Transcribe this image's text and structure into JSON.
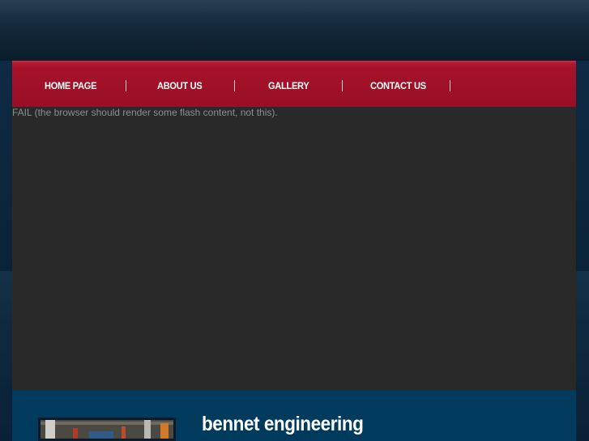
{
  "nav": {
    "items": [
      {
        "label": "HOME PAGE"
      },
      {
        "label": "ABOUT US"
      },
      {
        "label": "GALLERY"
      },
      {
        "label": "CONTACT US"
      }
    ]
  },
  "flash": {
    "fallback_text": "FAIL (the browser should render some flash content, not this)."
  },
  "content": {
    "site_title": "bennet engineering"
  },
  "colors": {
    "nav_red": "#a5122a",
    "flash_bg": "#292929",
    "content_blue": "#003a5c"
  }
}
